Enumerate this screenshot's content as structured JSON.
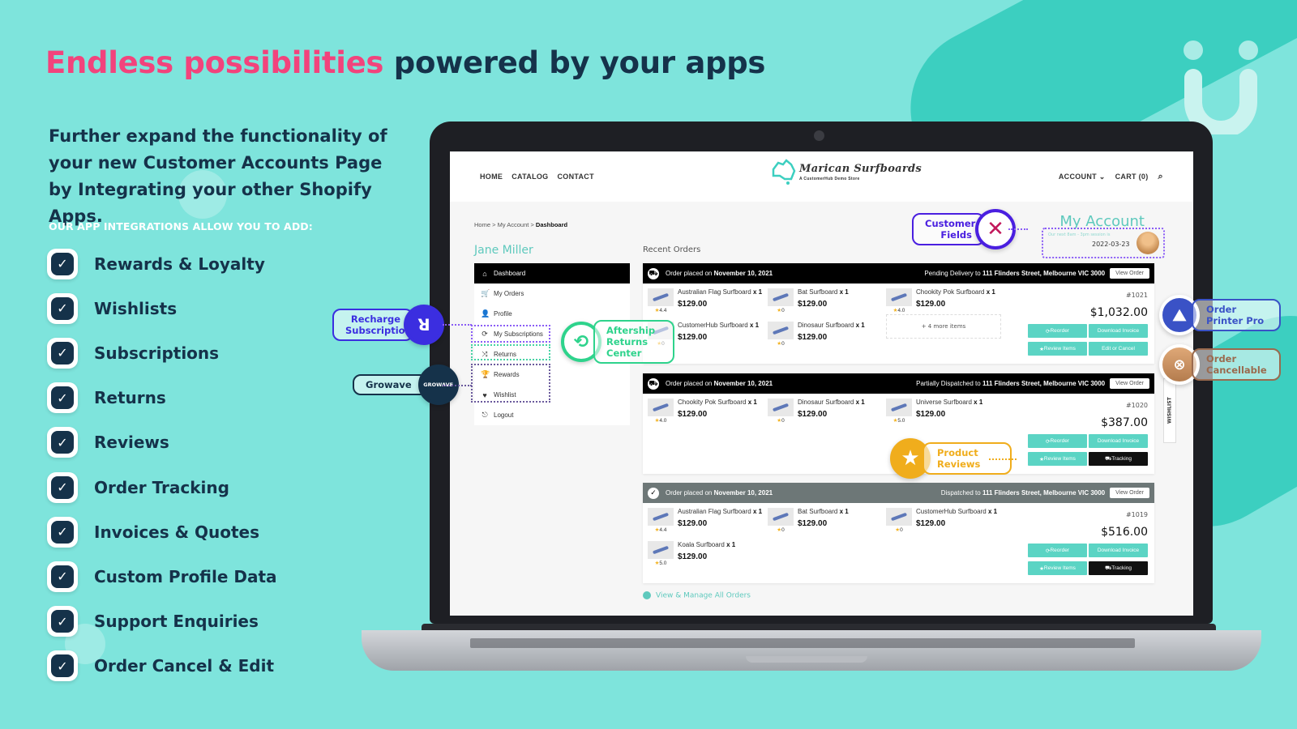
{
  "headline": {
    "highlight": "Endless possibilities",
    "rest": "powered by your apps"
  },
  "intro": "Further expand the functionality of your new Customer Accounts Page by Integrating your other Shopify Apps.",
  "subheading": "OUR APP INTEGRATIONS ALLOW YOU TO ADD:",
  "features": [
    "Rewards & Loyalty",
    "Wishlists",
    "Subscriptions",
    "Returns",
    "Reviews",
    "Order Tracking",
    "Invoices & Quotes",
    "Custom Profile Data",
    "Support Enquiries",
    "Order Cancel & Edit"
  ],
  "colors": {
    "accent_pink": "#f2437c",
    "dark_navy": "#15324a",
    "bg_teal": "#7ee4dc",
    "store_teal": "#5ec9bd"
  },
  "store": {
    "nav_left": [
      "HOME",
      "CATALOG",
      "CONTACT"
    ],
    "nav_account": "ACCOUNT",
    "nav_cart": "CART (0)",
    "logo_script": "Marican Surfboards",
    "logo_tagline": "A CustomerHub Demo Store",
    "breadcrumb": {
      "home": "Home",
      "account": "My Account",
      "current": "Dashboard",
      "sep": " > "
    },
    "user_name": "Jane Miller",
    "page_title": "My Account",
    "session_text": "Our next 8am - 3pm session is",
    "session_date": "2022-03-23",
    "menu": [
      {
        "label": "Dashboard",
        "icon": "home-icon",
        "glyph": "⌂"
      },
      {
        "label": "My Orders",
        "icon": "cart-icon",
        "glyph": "🛒"
      },
      {
        "label": "Profile",
        "icon": "user-icon",
        "glyph": "👤"
      },
      {
        "label": "My Subscriptions",
        "icon": "refresh-icon",
        "glyph": "⟳"
      },
      {
        "label": "Returns",
        "icon": "shuffle-icon",
        "glyph": "⤨"
      },
      {
        "label": "Rewards",
        "icon": "trophy-icon",
        "glyph": "🏆"
      },
      {
        "label": "Wishlist",
        "icon": "heart-icon",
        "glyph": "♥"
      },
      {
        "label": "Logout",
        "icon": "logout-icon",
        "glyph": "⎋"
      }
    ],
    "recent_orders_label": "Recent Orders",
    "view_order_label": "View Order",
    "orders": [
      {
        "placed_prefix": "Order placed on",
        "placed_date": "November 10, 2021",
        "status_prefix": "Pending Delivery to",
        "address": "111 Flinders Street, Melbourne VIC 3000",
        "number": "#1021",
        "total": "$1,032.00",
        "items": [
          {
            "name": "Australian Flag Surfboard",
            "qty": "x 1",
            "price": "$129.00",
            "rating": "4.4"
          },
          {
            "name": "Bat Surfboard",
            "qty": "x 1",
            "price": "$129.00",
            "rating": "0"
          },
          {
            "name": "Chookity Pok Surfboard",
            "qty": "x 1",
            "price": "$129.00",
            "rating": "4.0"
          },
          {
            "name": "CustomerHub Surfboard",
            "qty": "x 1",
            "price": "$129.00",
            "rating": "0"
          },
          {
            "name": "Dinosaur Surfboard",
            "qty": "x 1",
            "price": "$129.00",
            "rating": "0"
          }
        ],
        "more_items": "+ 4 more items",
        "buttons": [
          "Reorder",
          "Download Invoice",
          "Review Items",
          "Edit or Cancel"
        ]
      },
      {
        "placed_prefix": "Order placed on",
        "placed_date": "November 10, 2021",
        "status_prefix": "Partially Dispatched to",
        "address": "111 Flinders Street, Melbourne VIC 3000",
        "number": "#1020",
        "total": "$387.00",
        "items": [
          {
            "name": "Chookity Pok Surfboard",
            "qty": "x 1",
            "price": "$129.00",
            "rating": "4.0"
          },
          {
            "name": "Dinosaur Surfboard",
            "qty": "x 1",
            "price": "$129.00",
            "rating": "0"
          },
          {
            "name": "Universe Surfboard",
            "qty": "x 1",
            "price": "$129.00",
            "rating": "5.0"
          }
        ],
        "buttons": [
          "Reorder",
          "Download Invoice",
          "Review Items",
          "Tracking"
        ]
      },
      {
        "placed_prefix": "Order placed on",
        "placed_date": "November 10, 2021",
        "status_prefix": "Dispatched to",
        "address": "111 Flinders Street, Melbourne VIC 3000",
        "number": "#1019",
        "total": "$516.00",
        "items": [
          {
            "name": "Australian Flag Surfboard",
            "qty": "x 1",
            "price": "$129.00",
            "rating": "4.4"
          },
          {
            "name": "Bat Surfboard",
            "qty": "x 1",
            "price": "$129.00",
            "rating": "0"
          },
          {
            "name": "CustomerHub Surfboard",
            "qty": "x 1",
            "price": "$129.00",
            "rating": "0"
          },
          {
            "name": "Koala Surfboard",
            "qty": "x 1",
            "price": "$129.00",
            "rating": "5.0"
          }
        ],
        "buttons": [
          "Reorder",
          "Download Invoice",
          "Review Items",
          "Tracking"
        ]
      }
    ],
    "view_all_label": "View & Manage All Orders",
    "wishlist_tab": "WISHLIST"
  },
  "apps": {
    "recharge": "Recharge Subscriptions",
    "growave": "Growave",
    "growave_logo": "GROWAVE",
    "aftership": "Aftership Returns Center",
    "customer_fields": "Customer Fields",
    "printer": "Order Printer Pro",
    "cancellable": "Order Cancellable",
    "reviews": "Product Reviews"
  }
}
